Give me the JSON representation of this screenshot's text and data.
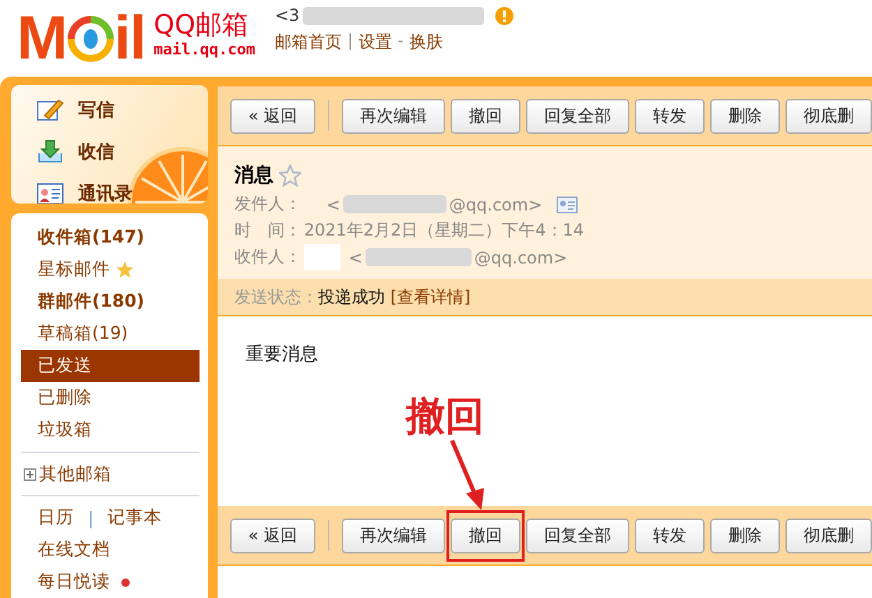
{
  "header": {
    "logo": {
      "left": "M",
      "right": "il"
    },
    "brand": "QQ邮箱",
    "domain": "mail.qq.com",
    "account_prefix": "<3",
    "nav": [
      {
        "kind": "link",
        "text": "邮箱首页"
      },
      {
        "kind": "separator",
        "text": "|"
      },
      {
        "kind": "link",
        "text": "设置"
      },
      {
        "kind": "separator",
        "text": "-"
      },
      {
        "kind": "link",
        "text": "换肤"
      }
    ]
  },
  "sidebar": {
    "actions": [
      {
        "kind": "compose",
        "label": "写信"
      },
      {
        "kind": "inbox",
        "label": "收信"
      },
      {
        "kind": "contacts",
        "label": "通讯录"
      }
    ],
    "folders": [
      {
        "label": "收件箱(147)",
        "bold": true,
        "selected": false,
        "starred": false
      },
      {
        "label": "星标邮件",
        "bold": false,
        "selected": false,
        "starred": true
      },
      {
        "label": "群邮件(180)",
        "bold": true,
        "selected": false,
        "starred": false
      },
      {
        "label": "草稿箱(19)",
        "bold": false,
        "selected": false,
        "starred": false
      },
      {
        "label": "已发送",
        "bold": false,
        "selected": true,
        "starred": false
      },
      {
        "label": "已删除",
        "bold": false,
        "selected": false,
        "starred": false
      },
      {
        "label": "垃圾箱",
        "bold": false,
        "selected": false,
        "starred": false
      }
    ],
    "other_mailboxes": {
      "label": "其他邮箱",
      "expanded": false
    },
    "tools": [
      {
        "kind": "pair",
        "items": [
          "日历",
          "|",
          "记事本"
        ]
      },
      {
        "kind": "single",
        "items": [
          "在线文档"
        ],
        "unread": false
      },
      {
        "kind": "single",
        "items": [
          "每日悦读"
        ],
        "unread": true
      }
    ]
  },
  "toolbar_top": [
    {
      "kind": "back",
      "label": "« 返回",
      "highlighted": false
    },
    {
      "kind": "action",
      "label": "再次编辑",
      "highlighted": false
    },
    {
      "kind": "action",
      "label": "撤回",
      "highlighted": false
    },
    {
      "kind": "action",
      "label": "回复全部",
      "highlighted": false
    },
    {
      "kind": "action",
      "label": "转发",
      "highlighted": false
    },
    {
      "kind": "action",
      "label": "删除",
      "highlighted": false
    },
    {
      "kind": "action",
      "label": "彻底删",
      "highlighted": false
    }
  ],
  "message": {
    "subject": "消息",
    "starred": false,
    "fields": [
      {
        "kind": "sender",
        "label": "发件人：",
        "prefix": "<",
        "suffix": "@qq.com>"
      },
      {
        "kind": "time",
        "label": "时　间：",
        "value": "2021年2月2日（星期二）下午4：14"
      },
      {
        "kind": "recipient",
        "label": "收件人：",
        "prefix": "<",
        "suffix": "@qq.com>"
      }
    ],
    "status": {
      "label": "发送状态：",
      "value": "投递成功",
      "link": "[查看详情]"
    },
    "body": "重要消息"
  },
  "annotation": {
    "text": "撤回"
  },
  "toolbar_bottom": [
    {
      "kind": "back",
      "label": "« 返回",
      "highlighted": false
    },
    {
      "kind": "action",
      "label": "再次编辑",
      "highlighted": false
    },
    {
      "kind": "action",
      "label": "撤回",
      "highlighted": true
    },
    {
      "kind": "action",
      "label": "回复全部",
      "highlighted": false
    },
    {
      "kind": "action",
      "label": "转发",
      "highlighted": false
    },
    {
      "kind": "action",
      "label": "删除",
      "highlighted": false
    },
    {
      "kind": "action",
      "label": "彻底删",
      "highlighted": false
    }
  ]
}
